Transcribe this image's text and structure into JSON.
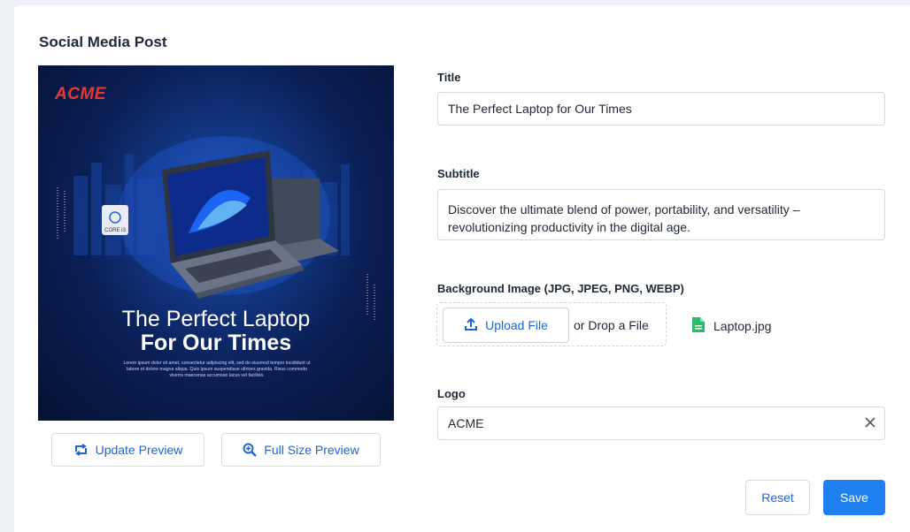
{
  "page": {
    "title": "Social Media Post"
  },
  "preview": {
    "logo": "ACME",
    "headline_line1": "The Perfect Laptop",
    "headline_line2": "For Our Times",
    "body_text": "Lorem ipsum dolor sit amet, consectetur adipiscing elit, sed do eiusmod tempor incididunt ut labore et dolore magna aliqua. Quis ipsum suspendisse ultrices gravida. Risus commodo viverra maecenas accumsan lacus vel facilisis.",
    "chip_badge": "CORE i3",
    "update_button": "Update Preview",
    "fullsize_button": "Full Size Preview"
  },
  "form": {
    "title_label": "Title",
    "title_value": "The Perfect Laptop for Our Times",
    "subtitle_label": "Subtitle",
    "subtitle_value": "Discover the ultimate blend of power, portability, and versatility – revolutionizing productivity in the digital age.",
    "bg_label": "Background Image (JPG, JPEG, PNG, WEBP)",
    "upload_button": "Upload File",
    "drop_text": "or Drop a File",
    "file_name": "Laptop.jpg",
    "logo_label": "Logo",
    "logo_value": "ACME"
  },
  "actions": {
    "reset": "Reset",
    "save": "Save"
  },
  "colors": {
    "accent": "#1f64d8",
    "primary": "#1f80f0",
    "file_icon": "#2dbb6b",
    "poster_logo": "#e53935"
  }
}
